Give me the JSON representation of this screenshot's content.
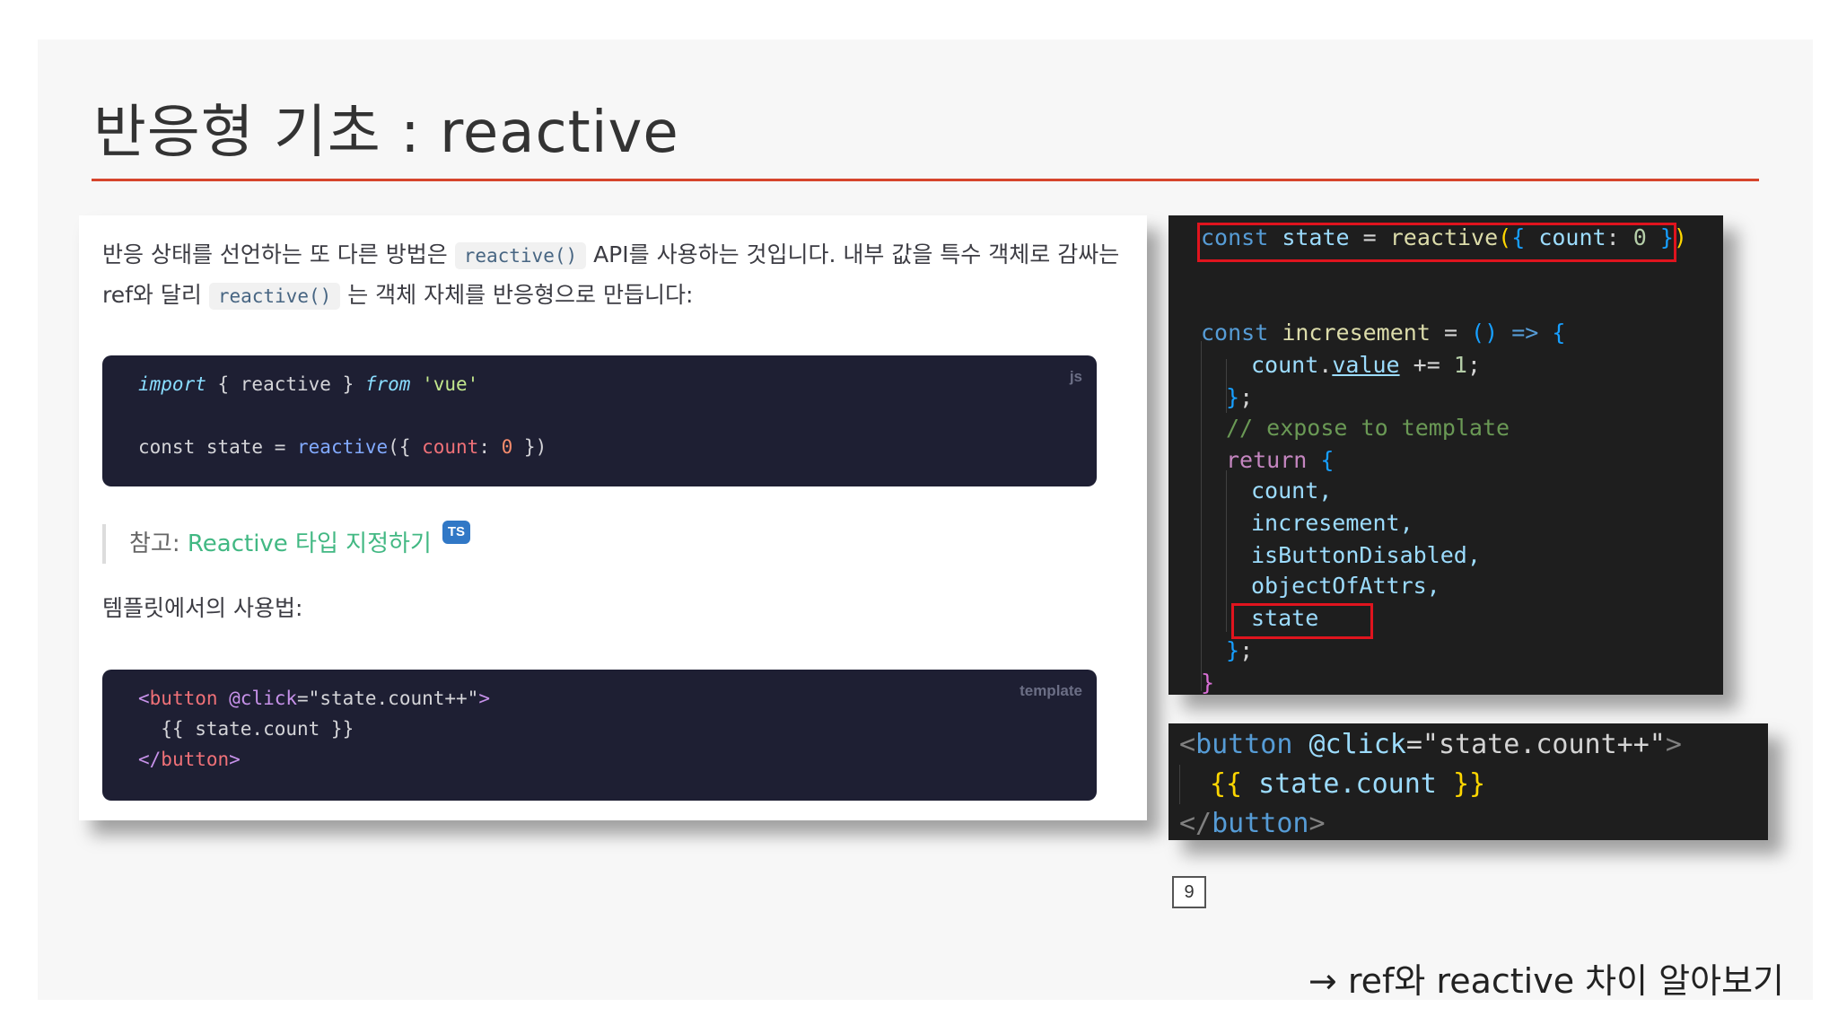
{
  "slide": {
    "title": "반응형 기초 : reactive",
    "page_number": "9",
    "footer_note": "→ ref와 reactive 차이 알아보기"
  },
  "doc": {
    "para1_a": "반응 상태를 선언하는 또 다른 방법은 ",
    "para1_code": "reactive()",
    "para1_b": " API를 사용하는 것입니다. 내부 값을 특수 객체로 감싸는 ref와 달리 ",
    "para1_code2": "reactive()",
    "para1_c": " 는 객체 자체를 반응형으로 만듭니다:",
    "code1_lang": "js",
    "code1_l1_kw1": "import",
    "code1_l1_a": " { reactive } ",
    "code1_l1_kw2": "from",
    "code1_l1_str": " 'vue'",
    "code1_l2_const": "const",
    "code1_l2_a": " state = ",
    "code1_l2_fn": "reactive",
    "code1_l2_b": "({ ",
    "code1_l2_prop": "count",
    "code1_l2_c": ": ",
    "code1_l2_num": "0",
    "code1_l2_d": " })",
    "note_prefix": "참고: ",
    "note_link": "Reactive 타입 지정하기",
    "note_badge": "TS",
    "para2": "템플릿에서의 사용법:",
    "code2_lang": "template",
    "code2_l1_lt": "<",
    "code2_l1_tag": "button",
    "code2_l1_attr": " @click",
    "code2_l1_val": "=\"state.count++\"",
    "code2_l1_gt": ">",
    "code2_l2": "  {{ state.count }}",
    "code2_l3_lt": "</",
    "code2_l3_tag": "button",
    "code2_l3_gt": ">"
  },
  "editor": {
    "l1_const": "const",
    "l1_state": " state",
    "l1_eq": " = ",
    "l1_fn": "reactive",
    "l1_p1": "(",
    "l1_b1": "{",
    "l1_count": " count",
    "l1_colon": ": ",
    "l1_num": "0",
    "l1_b2": " }",
    "l1_p2": ")",
    "l2_const": "const",
    "l2_name": " incresement",
    "l2_eq": " = ",
    "l2_paren": "()",
    "l2_arrow": " => ",
    "l2_brace": "{",
    "l3_count": "count",
    "l3_dot": ".",
    "l3_value": "value",
    "l3_rest": " += ",
    "l3_num": "1",
    "l3_semi": ";",
    "l4_brace": "}",
    "l4_semi": ";",
    "l5_comment": "// expose to template",
    "l6_return": "return",
    "l6_brace": " {",
    "l7": "count,",
    "l8": "incresement,",
    "l9": "isButtonDisabled,",
    "l10": "objectOfAttrs,",
    "l11": "state",
    "l12_brace": "}",
    "l12_semi": ";",
    "l13_brace": "}"
  },
  "editor2": {
    "l1_lt": "<",
    "l1_tag": "button",
    "l1_attr": " @click",
    "l1_val": "=\"state.count++\"",
    "l1_gt": ">",
    "l2_open": "{{",
    "l2_expr": " state.count ",
    "l2_close": "}}",
    "l3_lt": "</",
    "l3_tag": "button",
    "l3_gt": ">"
  }
}
